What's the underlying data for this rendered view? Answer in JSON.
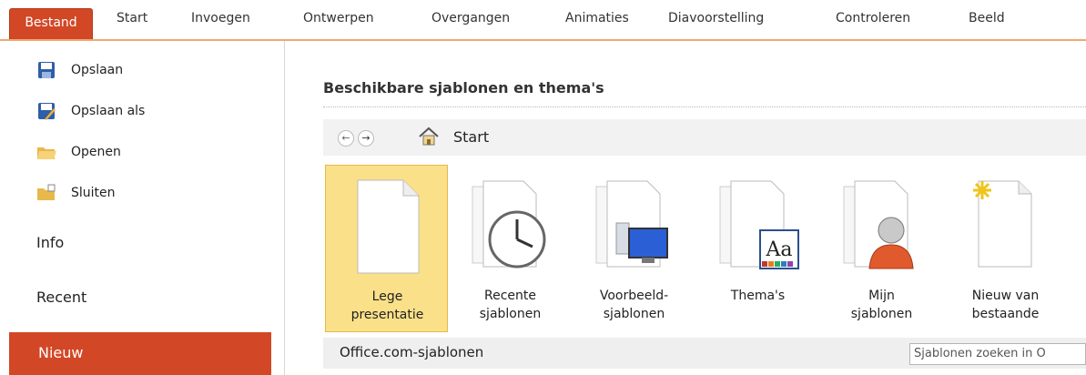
{
  "ribbon": {
    "file_tab": "Bestand",
    "tabs": [
      "Start",
      "Invoegen",
      "Ontwerpen",
      "Overgangen",
      "Animaties",
      "Diavoorstelling",
      "Controleren",
      "Beeld"
    ],
    "accent": "#d24726"
  },
  "backstage": {
    "commands": [
      "Opslaan",
      "Opslaan als",
      "Openen",
      "Sluiten"
    ],
    "sections": [
      "Info",
      "Recent",
      "Nieuw"
    ]
  },
  "main": {
    "heading": "Beschikbare sjablonen en thema's",
    "breadcrumb": "Start",
    "tiles": [
      {
        "line1": "Lege",
        "line2": "presentatie"
      },
      {
        "line1": "Recente",
        "line2": "sjablonen"
      },
      {
        "line1": "Voorbeeld-",
        "line2": "sjablonen"
      },
      {
        "line1": "Thema's",
        "line2": ""
      },
      {
        "line1": "Mijn",
        "line2": "sjablonen"
      },
      {
        "line1": "Nieuw van",
        "line2": "bestaande"
      }
    ],
    "office_section": "Office.com-sjablonen",
    "search_placeholder": "Sjablonen zoeken in O"
  }
}
